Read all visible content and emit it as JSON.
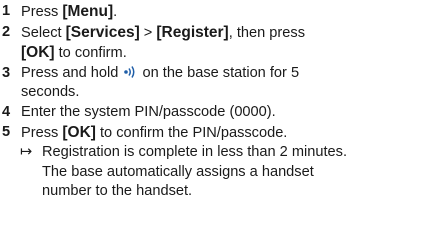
{
  "steps": [
    {
      "num": "1",
      "text_pre": "Press ",
      "kw1": "[Menu]",
      "text_post": "."
    },
    {
      "num": "2",
      "text_pre": "Select ",
      "kw1": "[Services]",
      "sep": " > ",
      "kw2": "[Register]",
      "text_mid": ", then press",
      "kw3": "[OK]",
      "text_post": " to confirm."
    },
    {
      "num": "3",
      "text_pre": "Press and hold ",
      "icon": "signal-wave-icon",
      "text_post": " on the base station for 5",
      "text_post2": "seconds."
    },
    {
      "num": "4",
      "text": "Enter the system PIN/passcode (0000)."
    },
    {
      "num": "5",
      "text_pre": "Press ",
      "kw1": "[OK]",
      "text_post": " to confirm the PIN/passcode."
    }
  ],
  "result": {
    "arrow": "↦",
    "line1": "Registration is complete in less than 2 minutes.",
    "line2": "The base automatically assigns a handset",
    "line3": "number to the handset."
  },
  "colors": {
    "icon": "#1f5ea8",
    "text": "#1a1a1a"
  }
}
